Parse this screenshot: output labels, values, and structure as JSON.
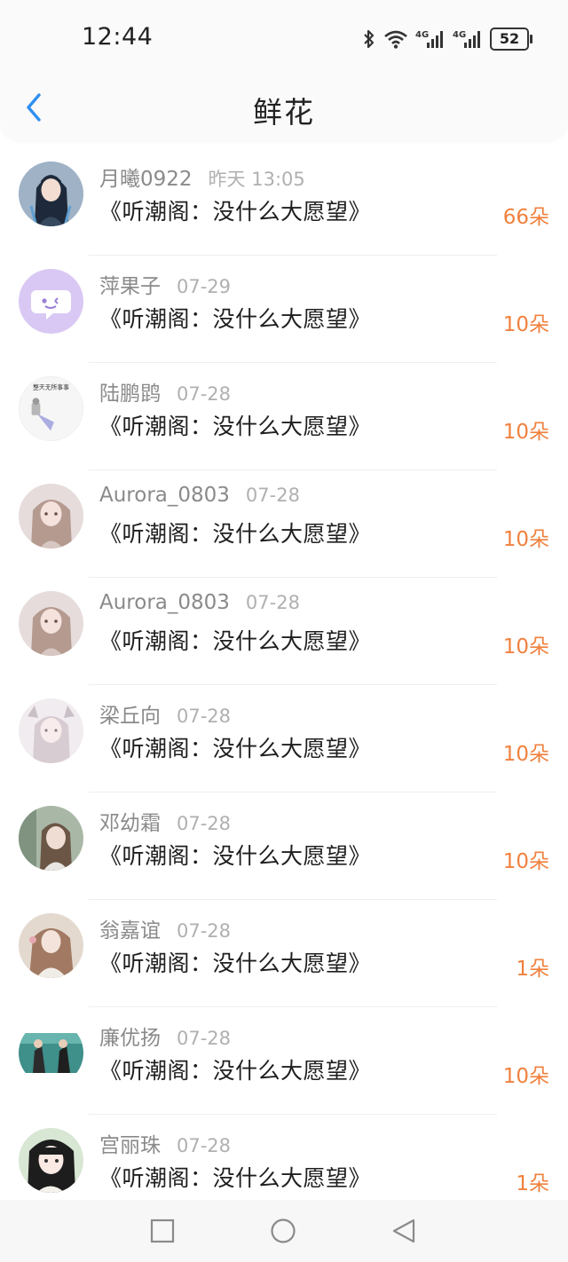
{
  "status_bar": {
    "time": "12:44",
    "battery": "52",
    "icons": [
      "bluetooth-icon",
      "wifi-icon",
      "signal-4g-icon",
      "signal-4g-icon",
      "battery-icon"
    ]
  },
  "header": {
    "title": "鲜花",
    "back_icon": "chevron-left-icon"
  },
  "colors": {
    "accent_blue": "#2f8ff0",
    "flower_orange": "#f0813e"
  },
  "rows": [
    {
      "user": "月曦0922",
      "date": "昨天 13:05",
      "book": "《听潮阁：没什么大愿望》",
      "count": "66朵"
    },
    {
      "user": "萍果子",
      "date": "07-29",
      "book": "《听潮阁：没什么大愿望》",
      "count": "10朵"
    },
    {
      "user": "陆鹏鹍",
      "date": "07-28",
      "book": "《听潮阁：没什么大愿望》",
      "count": "10朵",
      "avatar_text": "整天无所事事"
    },
    {
      "user": "Aurora_0803",
      "date": "07-28",
      "book": "《听潮阁：没什么大愿望》",
      "count": "10朵"
    },
    {
      "user": "Aurora_0803",
      "date": "07-28",
      "book": "《听潮阁：没什么大愿望》",
      "count": "10朵"
    },
    {
      "user": "梁丘向",
      "date": "07-28",
      "book": "《听潮阁：没什么大愿望》",
      "count": "10朵"
    },
    {
      "user": "邓幼霜",
      "date": "07-28",
      "book": "《听潮阁：没什么大愿望》",
      "count": "10朵"
    },
    {
      "user": "翁嘉谊",
      "date": "07-28",
      "book": "《听潮阁：没什么大愿望》",
      "count": "1朵"
    },
    {
      "user": "廉优扬",
      "date": "07-28",
      "book": "《听潮阁：没什么大愿望》",
      "count": "10朵"
    },
    {
      "user": "宫丽珠",
      "date": "07-28",
      "book": "《听潮阁：没什么大愿望》",
      "count": "1朵"
    }
  ],
  "system_nav": {
    "icons": [
      "recent-apps-icon",
      "home-icon",
      "back-triangle-icon"
    ]
  }
}
